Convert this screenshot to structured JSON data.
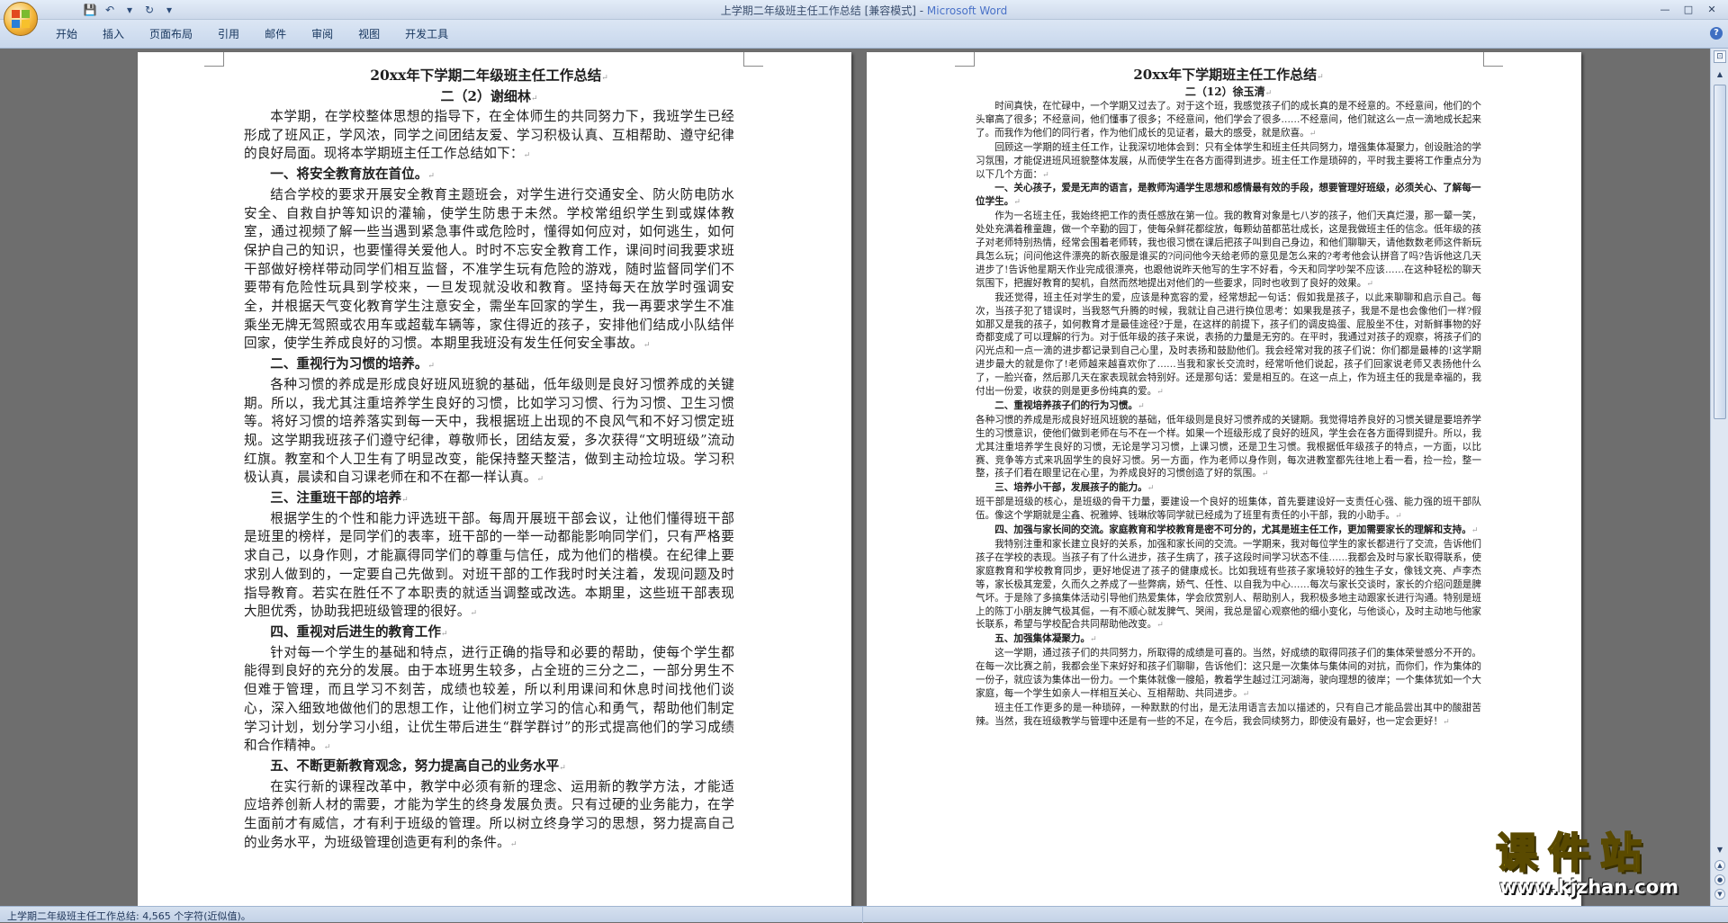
{
  "window": {
    "title_doc": "上学期二年级班主任工作总结 [兼容模式] - ",
    "title_app": "Microsoft Word",
    "controls": {
      "minimize": "—",
      "maximize": "□",
      "close": "✕"
    }
  },
  "qat": {
    "save": "💾",
    "undo": "↶",
    "undo_dd": "▾",
    "redo": "↻",
    "more": "▾"
  },
  "ribbon": {
    "tabs": [
      "开始",
      "插入",
      "页面布局",
      "引用",
      "邮件",
      "审阅",
      "视图",
      "开发工具"
    ],
    "help": "?"
  },
  "left_page": {
    "title": "20xx年下学期二年级班主任工作总结",
    "subtitle": "二（2）谢细林",
    "blocks": [
      {
        "kind": "para",
        "text": "本学期，在学校整体思想的指导下，在全体师生的共同努力下，我班学生已经形成了班风正，学风浓，同学之间团结友爱、学习积极认真、互相帮助、遵守纪律的良好局面。现将本学期班主任工作总结如下："
      },
      {
        "kind": "heading",
        "text": "一、将安全教育放在首位。"
      },
      {
        "kind": "para",
        "text": "结合学校的要求开展安全教育主题班会，对学生进行交通安全、防火防电防水安全、自救自护等知识的灌输，使学生防患于未然。学校常组织学生到或媒体教室，通过视频了解一些当遇到紧急事件或危险时，懂得如何应对，如何逃生，如何保护自己的知识，也要懂得关爱他人。时时不忘安全教育工作，课间时间我要求班干部做好榜样带动同学们相互监督，不准学生玩有危险的游戏，随时监督同学们不要带有危险性玩具到学校来，一旦发现就没收和教育。坚持每天在放学时强调安全，并根据天气变化教育学生注意安全，需坐车回家的学生，我一再要求学生不准乘坐无牌无驾照或农用车或超载车辆等，家住得近的孩子，安排他们结成小队结伴回家，使学生养成良好的习惯。本期里我班没有发生任何安全事故。"
      },
      {
        "kind": "heading",
        "text": "二、重视行为习惯的培养。"
      },
      {
        "kind": "para",
        "text": "各种习惯的养成是形成良好班风班貌的基础，低年级则是良好习惯养成的关键期。所以，我尤其注重培养学生良好的习惯，比如学习习惯、行为习惯、卫生习惯等。将好习惯的培养落实到每一天中，我根据班上出现的不良风气和不好习惯定班规。这学期我班孩子们遵守纪律，尊敬师长，团结友爱，多次获得“文明班级”流动红旗。教室和个人卫生有了明显改变，能保持整天整洁，做到主动捡垃圾。学习积极认真，晨读和自习课老师在和不在都一样认真。"
      },
      {
        "kind": "heading",
        "text": "三、注重班干部的培养"
      },
      {
        "kind": "para",
        "text": "根据学生的个性和能力评选班干部。每周开展班干部会议，让他们懂得班干部是班里的榜样，是同学们的表率，班干部的一举一动都能影响同学们，只有严格要求自己，以身作则，才能赢得同学们的尊重与信任，成为他们的楷模。在纪律上要求别人做到的，一定要自己先做到。对班干部的工作我时时关注着，发现问题及时指导教育。若实在胜任不了本职责的就适当调整或改选。本期里，这些班干部表现大胆优秀，协助我把班级管理的很好。"
      },
      {
        "kind": "heading",
        "text": "四、重视对后进生的教育工作"
      },
      {
        "kind": "para",
        "text": "针对每一个学生的基础和特点，进行正确的指导和必要的帮助，使每个学生都能得到良好的充分的发展。由于本班男生较多，占全班的三分之二，一部分男生不但难于管理，而且学习不刻苦，成绩也较差，所以利用课间和休息时间找他们谈心，深入细致地做他们的思想工作，让他们树立学习的信心和勇气，帮助他们制定学习计划，划分学习小组，让优生带后进生“群学群讨”的形式提高他们的学习成绩和合作精神。"
      },
      {
        "kind": "heading",
        "text": "五、不断更新教育观念，努力提高自己的业务水平"
      },
      {
        "kind": "para",
        "text": "在实行新的课程改革中，教学中必须有新的理念、运用新的教学方法，才能适应培养创新人材的需要，才能为学生的终身发展负责。只有过硬的业务能力，在学生面前才有威信，才有利于班级的管理。所以树立终身学习的思想，努力提高自己的业务水平，为班级管理创造更有利的条件。"
      }
    ]
  },
  "right_page": {
    "title": "20xx年下学期班主任工作总结",
    "subtitle": "二（12）徐玉清",
    "blocks": [
      {
        "kind": "para",
        "text": "时间真快，在忙碌中，一个学期又过去了。对于这个班，我感觉孩子们的成长真的是不经意的。不经意间，他们的个头窜高了很多；不经意间，他们懂事了很多；不经意间，他们学会了很多……不经意间，他们就这么一点一滴地成长起来了。而我作为他们的同行者，作为他们成长的见证者，最大的感受，就是欣喜。"
      },
      {
        "kind": "para",
        "text": "回顾这一学期的班主任工作，让我深切地体会到：只有全体学生和班主任共同努力，增强集体凝聚力，创设融洽的学习氛围，才能促进班风班貌整体发展，从而使学生在各方面得到进步。班主任工作是琐碎的，平时我主要将工作重点分为以下几个方面："
      },
      {
        "kind": "heading",
        "text": "一、关心孩子，爱是无声的语言，是教师沟通学生思想和感情最有效的手段，想要管理好班级，必须关心、了解每一位学生。"
      },
      {
        "kind": "para",
        "text": "作为一名班主任，我始终把工作的责任感放在第一位。我的教育对象是七八岁的孩子，他们天真烂漫，那一颦一笑，处处充满着稚童趣，做一个辛勤的园丁，使每朵鲜花都绽放，每颗幼苗都茁壮成长，这是我做班主任的信念。低年级的孩子对老师特别热情，经常会围着老师转，我也很习惯在课后把孩子叫到自己身边，和他们聊聊天，请他数数老师这件新玩具怎么玩；问问他这件漂亮的新衣服是谁买的?问问他今天给老师的意见是怎么来的?考考他会认拼音了吗?告诉他这几天进步了!告诉他星期天作业完成很漂亮，也跟他说昨天他写的生字不好看，今天和同学吵架不应该……在这种轻松的聊天氛围下，把握好教育的契机，自然而然地提出对他们的一些要求，同时也收到了良好的效果。"
      },
      {
        "kind": "para",
        "text": "我还觉得，班主任对学生的爱，应该是种宽容的爱，经常想起一句话：假如我是孩子，以此来聊聊和启示自己。每次，当孩子犯了错误时，当我怒气升腾的时候，我就让自己进行换位思考：如果我是孩子，我是不是也会像他们一样?假如那又是我的孩子，如何教育才是最佳途径?于是，在这样的前提下，孩子们的调皮捣蛋、屁股坐不住，对新鲜事物的好奇都变成了可以理解的行为。对于低年级的孩子来说，表扬的力量是无穷的。在平时，我通过对孩子的观察，将孩子们的闪光点和一点一滴的进步都记录到自己心里，及时表扬和鼓励他们。我会经常对我的孩子们说：你们都是最棒的!这学期进步最大的就是你了!老师越来越喜欢你了……当我和家长交流时，经常听他们说起，孩子们回家说老师又表扬他什么了，一脸兴奋，然后那几天在家表现就会特别好。还是那句话：爱是相互的。在这一点上，作为班主任的我是幸福的，我付出一份爱，收获的则是更多份纯真的爱。"
      },
      {
        "kind": "heading",
        "text": "二、重视培养孩子们的行为习惯。"
      },
      {
        "kind": "para_noindent",
        "text": "各种习惯的养成是形成良好班风班貌的基础，低年级则是良好习惯养成的关键期。我觉得培养良好的习惯关键是要培养学生的习惯意识，使他们做到老师在与不在一个样。如果一个班级形成了良好的班风，学生会在各方面得到提升。所以，我尤其注重培养学生良好的习惯，无论是学习习惯，上课习惯，还是卫生习惯。我根据低年级孩子的特点，一方面，以比赛、竞争等方式来巩固学生的良好习惯。另一方面，作为老师以身作则，每次进教室都先往地上看一看，捡一捡，整一整，孩子们看在眼里记在心里，为养成良好的习惯创造了好的氛围。"
      },
      {
        "kind": "heading",
        "text": "三、培养小干部，发展孩子的能力。"
      },
      {
        "kind": "para_noindent",
        "text": "班干部是班级的核心，是班级的骨干力量，要建设一个良好的班集体，首先要建设好一支责任心强、能力强的班干部队伍。像这个学期就是尘鑫、祝雅婷、钱琳欣等同学就已经成为了班里有责任的小干部，我的小助手。"
      },
      {
        "kind": "heading",
        "text": "四、加强与家长间的交流。家庭教育和学校教育是密不可分的，尤其是班主任工作，更加需要家长的理解和支持。"
      },
      {
        "kind": "para",
        "text": "我特别注重和家长建立良好的关系，加强和家长间的交流。一学期来，我对每位学生的家长都进行了交流，告诉他们孩子在学校的表现。当孩子有了什么进步，孩子生病了，孩子这段时间学习状态不佳……我都会及时与家长取得联系，使家庭教育和学校教育同步，更好地促进了孩子的健康成长。比如我班有些孩子家境较好的独生子女，像钱文亮、卢李杰等，家长极其宠爱，久而久之养成了一些弊病，娇气、任性、以自我为中心……每次与家长交谈时，家长的介绍问题是脾气坏。于是除了多搞集体活动引导他们热爱集体，学会欣赏别人、帮助别人，我积极多地主动跟家长进行沟通。特别是班上的陈丁小朋友脾气极其倔，一有不顺心就发脾气、哭闹，我总是留心观察他的细小变化，与他谈心，及时主动地与他家长联系，希望与学校配合共同帮助他改变。"
      },
      {
        "kind": "heading",
        "text": "五、加强集体凝聚力。"
      },
      {
        "kind": "para",
        "text": "这一学期，通过孩子们的共同努力，所取得的成绩是可喜的。当然，好成绩的取得同孩子们的集体荣誉感分不开的。在每一次比赛之前，我都会坐下来好好和孩子们聊聊，告诉他们：这只是一次集体与集体间的对抗，而你们，作为集体的一份子，就应该为集体出一份力。一个集体就像一艘船，教着学生越过江河湖海，驶向理想的彼岸；一个集体犹如一个大家庭，每一个学生如亲人一样相互关心、互相帮助、共同进步。"
      },
      {
        "kind": "para",
        "text": "班主任工作更多的是一种琐碎，一种默默的付出，是无法用语言去加以描述的，只有自己才能品尝出其中的酸甜苦辣。当然，我在班级教学与管理中还是有一些的不足，在今后，我会同续努力，即使没有最好，也一定会更好！"
      }
    ]
  },
  "scrollbar": {
    "ruler": "⊡",
    "up": "▲",
    "down": "▼",
    "prev": "▲",
    "select": "●",
    "next": "▼"
  },
  "watermark": {
    "main": "课件站",
    "url": "www.kjzhan.com"
  },
  "status": {
    "text": "上学期二年级班主任工作总结: 4,565 个字符(近似值)。"
  },
  "colors": {
    "ribbon": "#c8d7ec",
    "title_app": "#4a72c8",
    "workspace": "#6e6e6e",
    "office_orange": "#f3b63a"
  }
}
